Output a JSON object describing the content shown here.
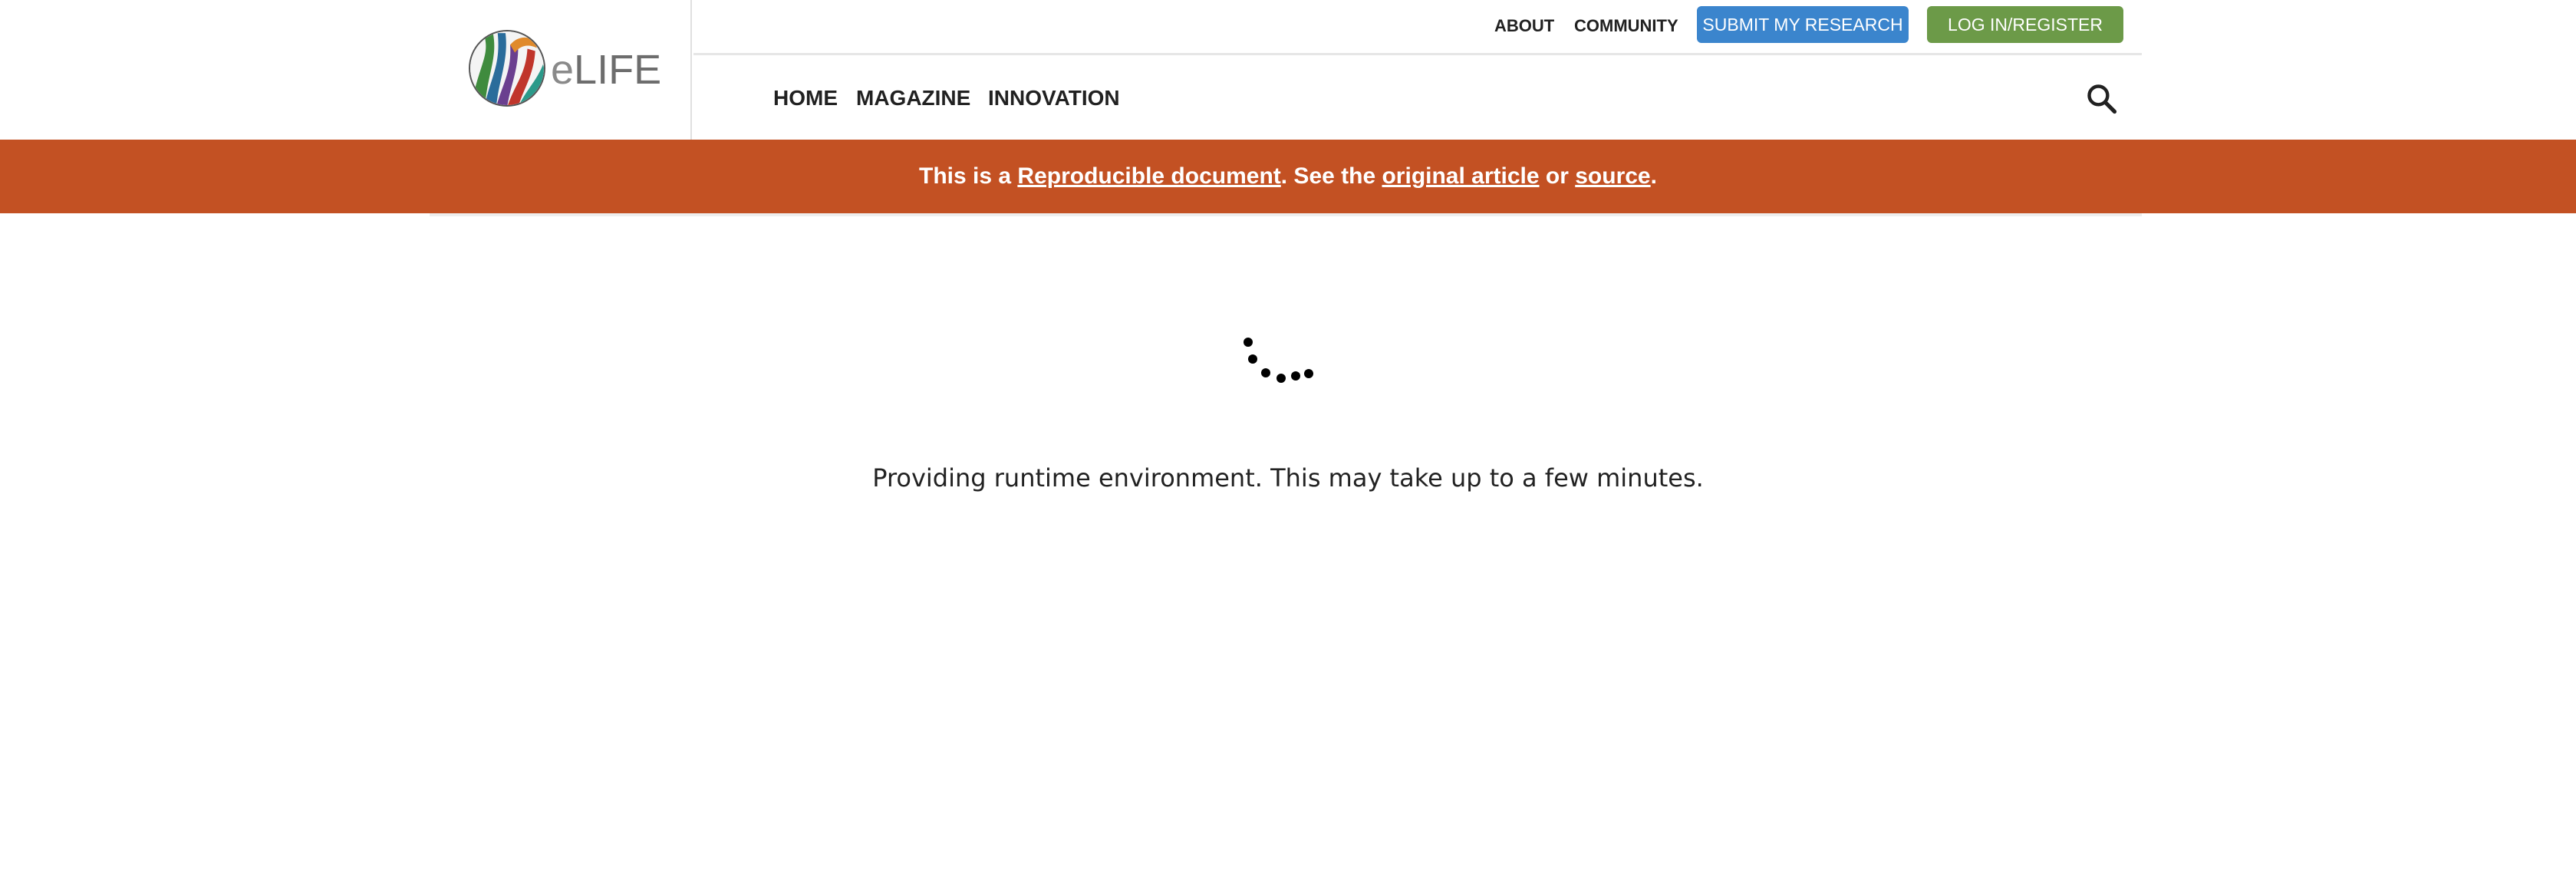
{
  "header": {
    "logo": {
      "text_prefix": "e",
      "text_main": "LIFE",
      "colors": [
        "#2a6c9b",
        "#3f8b3e",
        "#c0352b",
        "#6a3f8f",
        "#2b9a8a",
        "#e08a2b"
      ]
    },
    "util_nav": {
      "about": "ABOUT",
      "community": "COMMUNITY",
      "submit": "SUBMIT MY RESEARCH",
      "login": "LOG IN/REGISTER"
    },
    "main_nav": {
      "home": "HOME",
      "magazine": "MAGAZINE",
      "innovation": "INNOVATION"
    },
    "colors": {
      "submit_bg": "#3b85cd",
      "login_bg": "#6c9a48"
    }
  },
  "banner": {
    "prefix": "This is a ",
    "link1": "Reproducible document",
    "middle": ". See the ",
    "link2": "original article",
    "or": " or ",
    "link3": "source",
    "suffix": ".",
    "bg_color": "#c35123"
  },
  "loading": {
    "icon": "loading-spinner-icon",
    "message": "Providing runtime environment. This may take up to a few minutes."
  }
}
